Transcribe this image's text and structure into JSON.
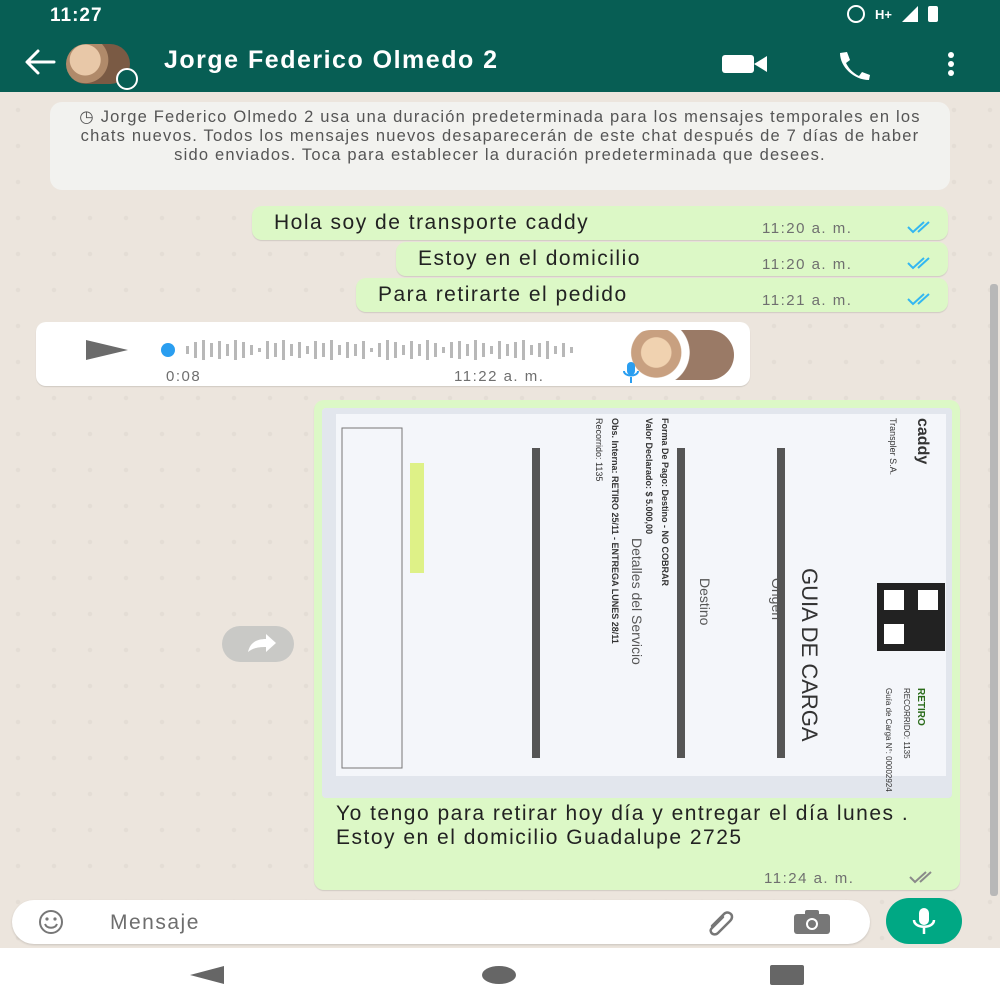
{
  "status_bar": {
    "time": "11:27",
    "network": "H+"
  },
  "header": {
    "contact_name": "Jorge Federico Olmedo 2"
  },
  "system_message": {
    "text": "Jorge Federico Olmedo 2 usa una duración predeterminada para los mensajes temporales en los chats nuevos. Todos los mensajes nuevos desaparecerán de este chat después de 7 días de haber sido enviados. Toca para establecer la duración predeterminada que desees."
  },
  "messages": [
    {
      "text": "Hola soy de transporte caddy",
      "time": "11:20 a. m."
    },
    {
      "text": "Estoy en el domicilio",
      "time": "11:20 a. m."
    },
    {
      "text": "Para retirarte el pedido",
      "time": "11:21 a. m."
    }
  ],
  "voice_message": {
    "duration": "0:08",
    "time": "11:22 a. m."
  },
  "image_message": {
    "caption": "Yo tengo para retirar hoy día y entregar el día lunes . Estoy en el domicilio Guadalupe 2725",
    "time": "11:24 a. m.",
    "document": {
      "title": "GUIA DE CARGA",
      "badge": "RETIRO",
      "badge_sub": "RECORRIDO: 1135",
      "origin_label": "Origen",
      "destination_label": "Destino",
      "service_label": "Detalles del Servicio",
      "brand": "caddy",
      "company": "Transpler S.A.",
      "guide_line": "Guía de Carga N°: 00002924",
      "payment_line": "Forma De Pago: Destino - NO COBRAR",
      "declared_line": "Valor Declarado: $ 5.000,00",
      "retiro_line": "Obs. Interna: RETIRO 25/11 - ENTREGA LUNES 28/11",
      "recorrido_line": "Recorrido: 1135"
    }
  },
  "input": {
    "placeholder": "Mensaje"
  },
  "colors": {
    "header": "#075e54",
    "outgoing": "#dcf8c6",
    "incoming": "#ffffff",
    "tick_read": "#34b7f1",
    "accent": "#00a884"
  }
}
